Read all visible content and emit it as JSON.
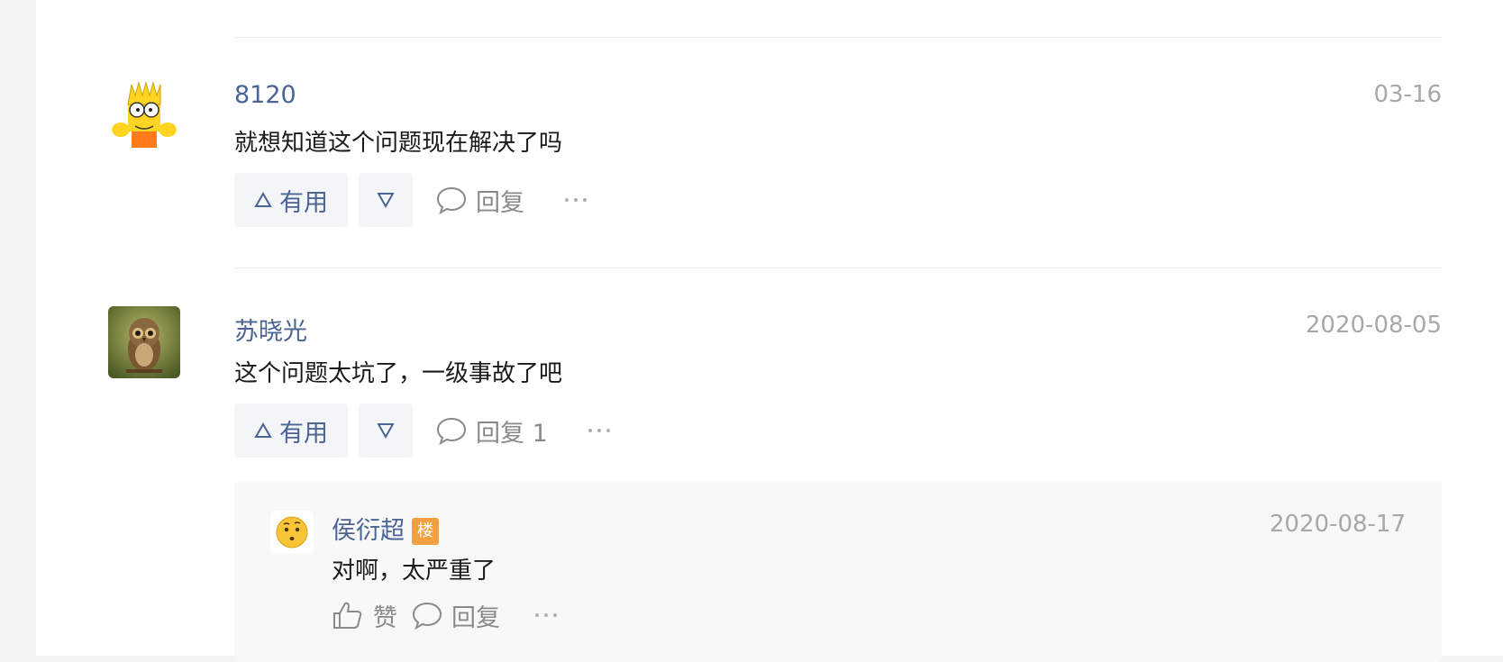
{
  "comments": [
    {
      "username": "8120",
      "date": "03-16",
      "content": "就想知道这个问题现在解决了吗",
      "useful_label": "有用",
      "reply_label": "回复",
      "avatar_icon": "bart-simpson-avatar"
    },
    {
      "username": "苏晓光",
      "date": "2020-08-05",
      "content": "这个问题太坑了，一级事故了吧",
      "useful_label": "有用",
      "reply_label": "回复 1",
      "avatar_icon": "owl-photo-avatar"
    }
  ],
  "subreply": {
    "username": "侯衍超",
    "badge": "楼",
    "date": "2020-08-17",
    "content": "对啊，太严重了",
    "like_label": "赞",
    "reply_label": "回复",
    "avatar_icon": "thinking-emoji-avatar"
  },
  "colors": {
    "link": "#4a6496",
    "muted": "#a8a8a8",
    "badge": "#f0a040"
  }
}
